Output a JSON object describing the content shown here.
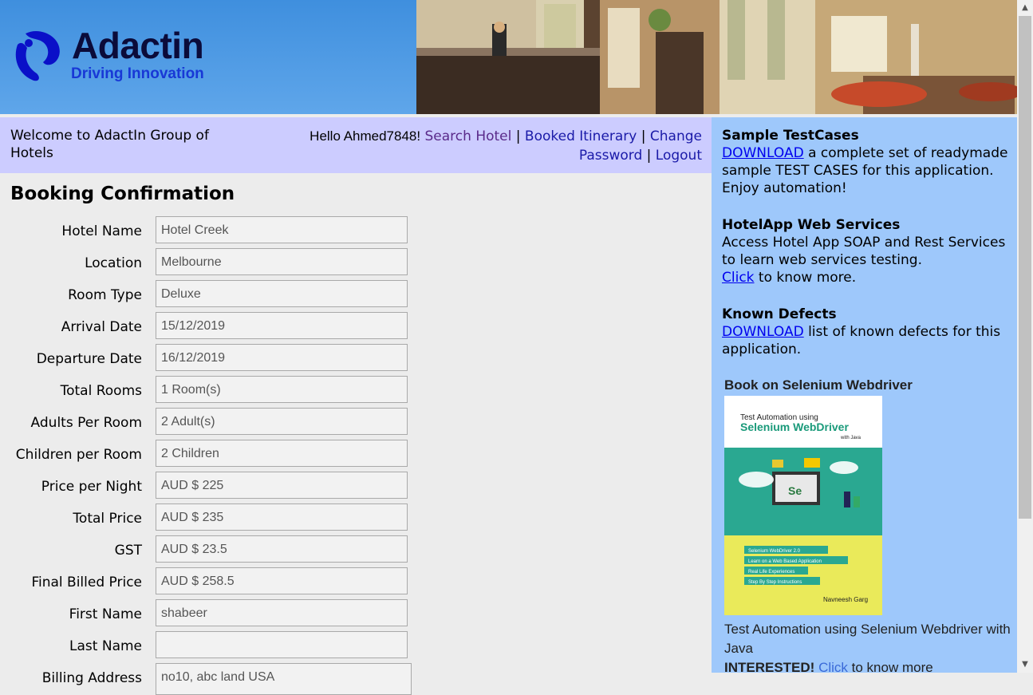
{
  "header": {
    "logo_title": "Adactin",
    "logo_tagline": "Driving Innovation"
  },
  "nav": {
    "welcome": "Welcome to AdactIn Group of Hotels",
    "hello": "Hello Ahmed7848!",
    "search_hotel": "Search Hotel",
    "booked_itinerary": "Booked Itinerary",
    "change_password": "Change Password",
    "logout": "Logout",
    "separator": "|"
  },
  "page_title": "Booking Confirmation",
  "form": {
    "fields": [
      {
        "label": "Hotel Name",
        "value": "Hotel Creek"
      },
      {
        "label": "Location",
        "value": "Melbourne"
      },
      {
        "label": "Room Type",
        "value": "Deluxe"
      },
      {
        "label": "Arrival Date",
        "value": "15/12/2019"
      },
      {
        "label": "Departure Date",
        "value": "16/12/2019"
      },
      {
        "label": "Total Rooms",
        "value": "1 Room(s)"
      },
      {
        "label": "Adults Per Room",
        "value": "2 Adult(s)"
      },
      {
        "label": "Children per Room",
        "value": "2 Children"
      },
      {
        "label": "Price per Night",
        "value": "AUD $ 225"
      },
      {
        "label": "Total Price",
        "value": "AUD $ 235"
      },
      {
        "label": "GST",
        "value": "AUD $ 23.5"
      },
      {
        "label": "Final Billed Price",
        "value": "AUD $ 258.5"
      },
      {
        "label": "First Name",
        "value": "shabeer"
      },
      {
        "label": "Last Name",
        "value": ""
      },
      {
        "label": "Billing Address",
        "value": "no10, abc land USA"
      }
    ]
  },
  "sidebar": {
    "sample_title": "Sample TestCases",
    "sample_link": "DOWNLOAD",
    "sample_text": " a complete set of readymade sample TEST CASES for this application. Enjoy automation!",
    "ws_title": "HotelApp Web Services",
    "ws_text": "Access Hotel App SOAP and Rest Services to learn web services testing.",
    "ws_link": "Click",
    "ws_suffix": " to know more.",
    "defects_title": "Known Defects",
    "defects_link": "DOWNLOAD",
    "defects_text": " list of known defects for this application.",
    "book_heading": "Book on Selenium Webdriver",
    "book_caption": "Test Automation using Selenium Webdriver with Java",
    "interested": "INTERESTED!",
    "interested_link": "Click",
    "interested_suffix": " to know more",
    "cover": {
      "line1": "Test Automation using",
      "line2": "Selenium WebDriver",
      "line3": "with Java",
      "bullets": [
        "Selenium WebDriver 2.0",
        "Learn on a Web Based Application",
        "Real Life Experiences",
        "Step By Step Instructions"
      ],
      "author": "Navneesh Garg"
    }
  },
  "colors": {
    "nav_bg": "#ccccff",
    "sidebar_bg": "#9ec8fb",
    "header_blue": "#3f8fde",
    "link": "#1a1aa8"
  }
}
